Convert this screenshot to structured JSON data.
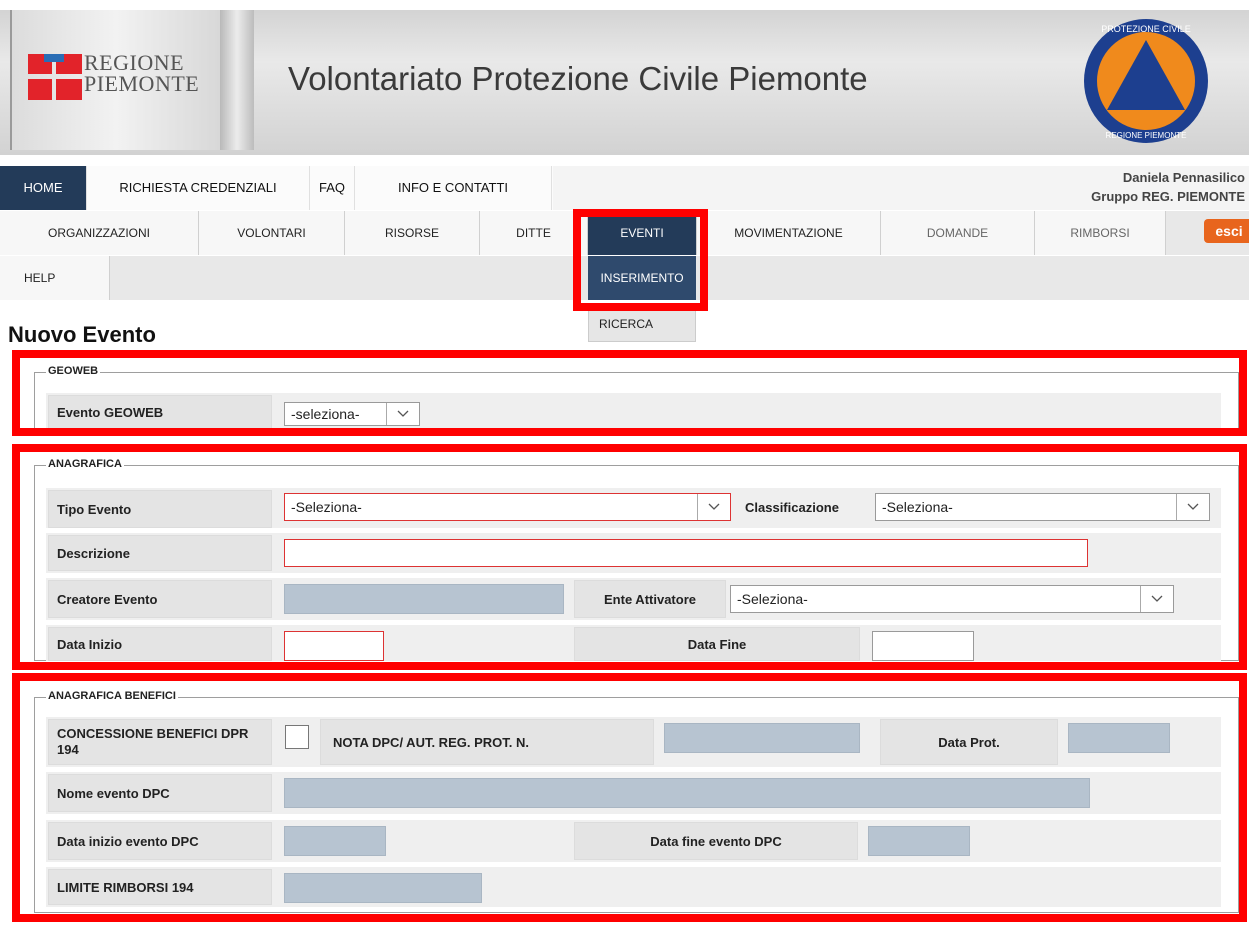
{
  "header": {
    "logo_line1": "REGIONE",
    "logo_line2": "PIEMONTE",
    "title": "Volontariato Protezione Civile Piemonte",
    "emblem_top": "PROTEZIONE CIVILE",
    "emblem_bottom": "REGIONE PIEMONTE"
  },
  "topnav": {
    "items": [
      "HOME",
      "RICHIESTA CREDENZIALI",
      "FAQ",
      "INFO E CONTATTI"
    ],
    "user_name": "Daniela Pennasilico",
    "user_group": "Gruppo REG. PIEMONTE"
  },
  "mainnav": {
    "items": [
      "ORGANIZZAZIONI",
      "VOLONTARI",
      "RISORSE",
      "DITTE",
      "EVENTI",
      "MOVIMENTAZIONE",
      "DOMANDE",
      "RIMBORSI"
    ],
    "esci": "esci",
    "help": "HELP",
    "dropdown": [
      "INSERIMENTO",
      "RICERCA"
    ]
  },
  "page_title": "Nuovo Evento",
  "geoweb": {
    "legend": "GEOWEB",
    "evento_label": "Evento GEOWEB",
    "evento_value": "-seleziona-"
  },
  "anagrafica": {
    "legend": "ANAGRAFICA",
    "tipo_label": "Tipo Evento",
    "tipo_value": "-Seleziona-",
    "class_label": "Classificazione",
    "class_value": "-Seleziona-",
    "descr_label": "Descrizione",
    "creatore_label": "Creatore Evento",
    "ente_label": "Ente Attivatore",
    "ente_value": "-Seleziona-",
    "data_inizio_label": "Data Inizio",
    "data_fine_label": "Data Fine"
  },
  "benefici": {
    "legend": "ANAGRAFICA BENEFICI",
    "concessione_label": "CONCESSIONE BENEFICI DPR 194",
    "nota_label": "NOTA DPC/ AUT. REG. PROT. N.",
    "data_prot_label": "Data Prot.",
    "nome_label": "Nome evento DPC",
    "inizio_label": "Data inizio evento DPC",
    "fine_label": "Data fine evento DPC",
    "limite_label": "LIMITE RIMBORSI 194"
  },
  "colors": {
    "nav_active": "#233b59",
    "highlight": "#ff0000",
    "esci": "#e8651d",
    "readonly_field": "#b7c4d1"
  }
}
